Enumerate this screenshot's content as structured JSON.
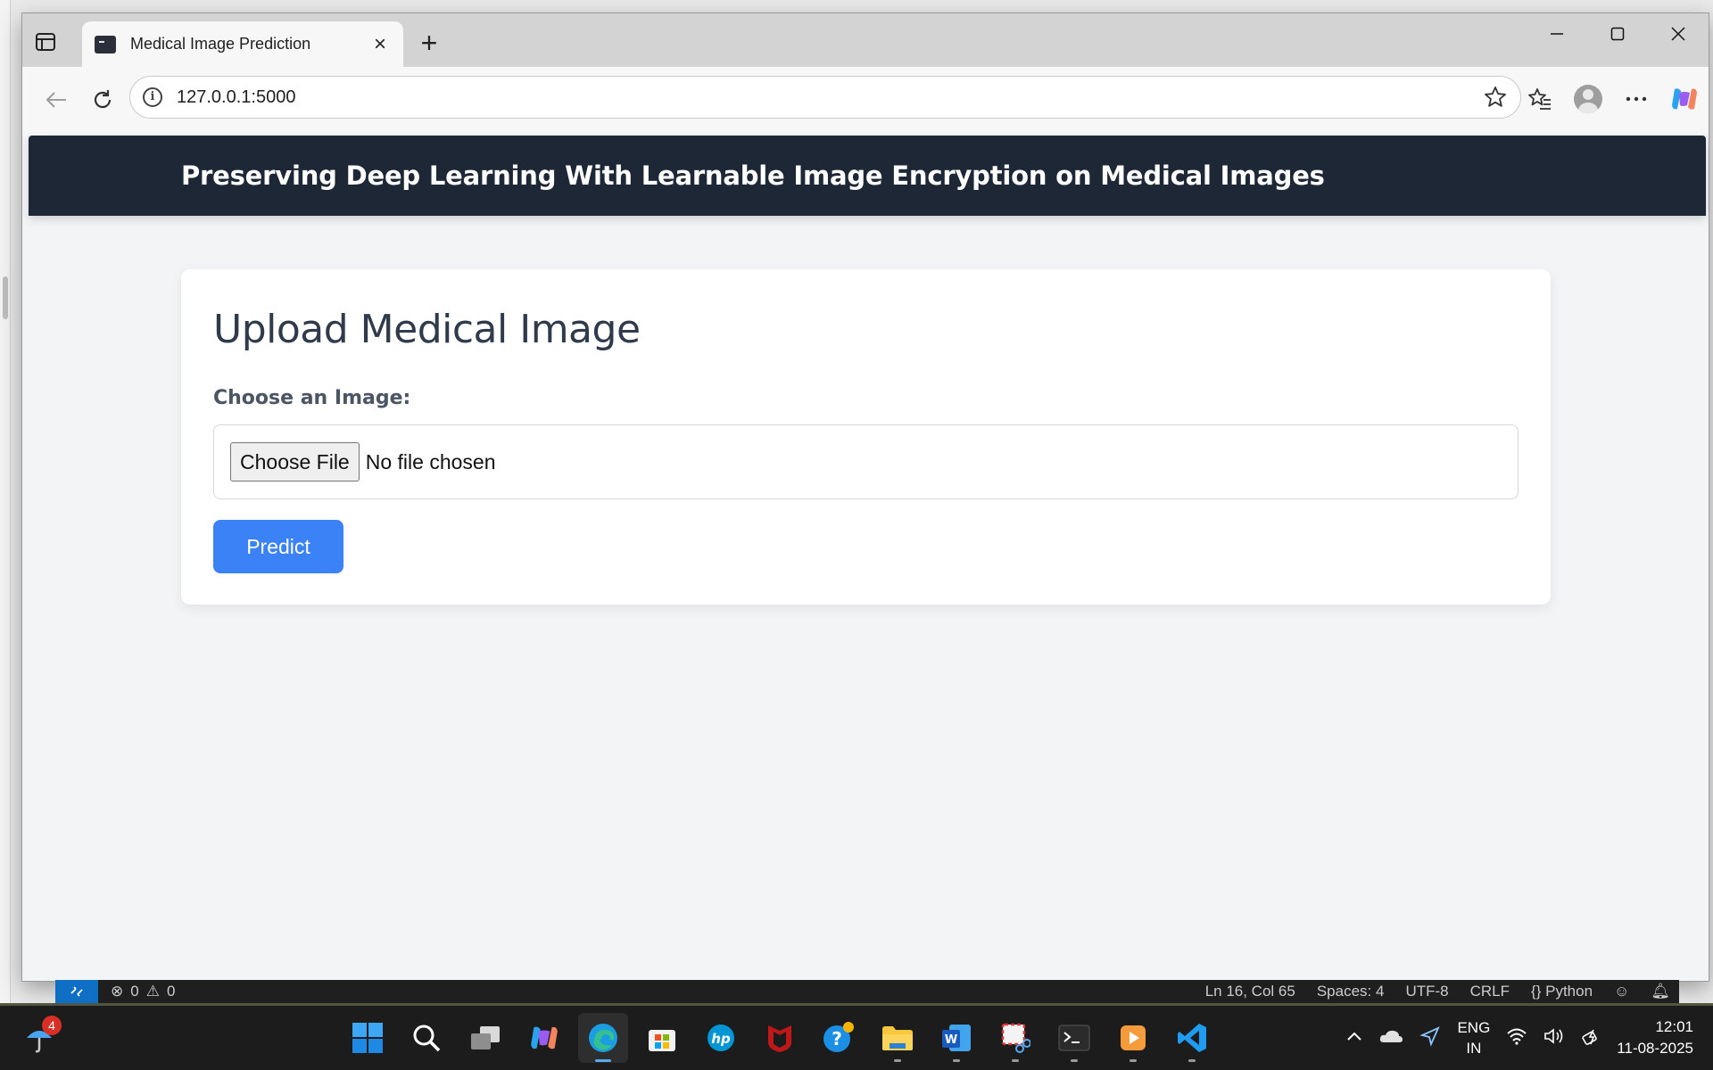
{
  "browser": {
    "tab_title": "Medical Image Prediction",
    "url": "127.0.0.1:5000"
  },
  "page": {
    "header_title": "Preserving Deep Learning With Learnable Image Encryption on Medical Images",
    "card_title": "Upload Medical Image",
    "file_label": "Choose an Image:",
    "file_button": "Choose File",
    "file_status": "No file chosen",
    "predict_button": "Predict"
  },
  "statusbar": {
    "errors": "0",
    "warnings": "0",
    "position": "Ln 16, Col 65",
    "spaces": "Spaces: 4",
    "encoding": "UTF-8",
    "eol": "CRLF",
    "language": "Python"
  },
  "taskbar": {
    "weather_badge": "4",
    "lang_top": "ENG",
    "lang_bottom": "IN",
    "time": "12:01",
    "date": "11-08-2025"
  },
  "colors": {
    "header_bg": "#1d2736",
    "predict_bg": "#3b82f6",
    "page_bg": "#f3f4f6"
  }
}
